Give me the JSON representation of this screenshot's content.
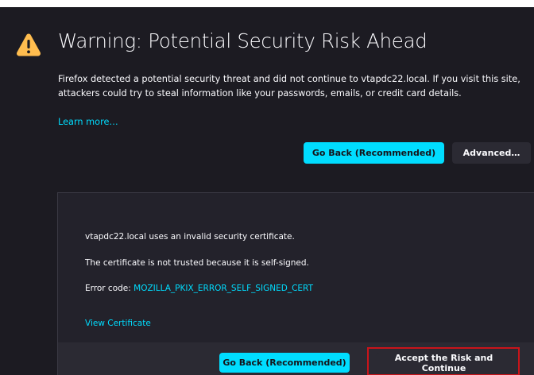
{
  "page": {
    "title": "Warning: Potential Security Risk Ahead",
    "description": "Firefox detected a potential security threat and did not continue to vtapdc22.local. If you visit this site, attackers could try to steal information like your passwords, emails, or credit card details.",
    "learn_more": "Learn more…",
    "buttons": {
      "go_back": "Go Back (Recommended)",
      "advanced": "Advanced…"
    }
  },
  "details": {
    "line1": "vtapdc22.local uses an invalid security certificate.",
    "line2": "The certificate is not trusted because it is self-signed.",
    "error_code_label": "Error code: ",
    "error_code": "MOZILLA_PKIX_ERROR_SELF_SIGNED_CERT",
    "view_certificate": "View Certificate",
    "buttons": {
      "go_back": "Go Back (Recommended)",
      "accept": "Accept the Risk and Continue"
    }
  },
  "colors": {
    "background": "#1c1b22",
    "accent": "#00ddff",
    "warning": "#ffbd4f",
    "highlight": "#c9141a"
  },
  "icons": {
    "warning": "warning-triangle-icon"
  }
}
